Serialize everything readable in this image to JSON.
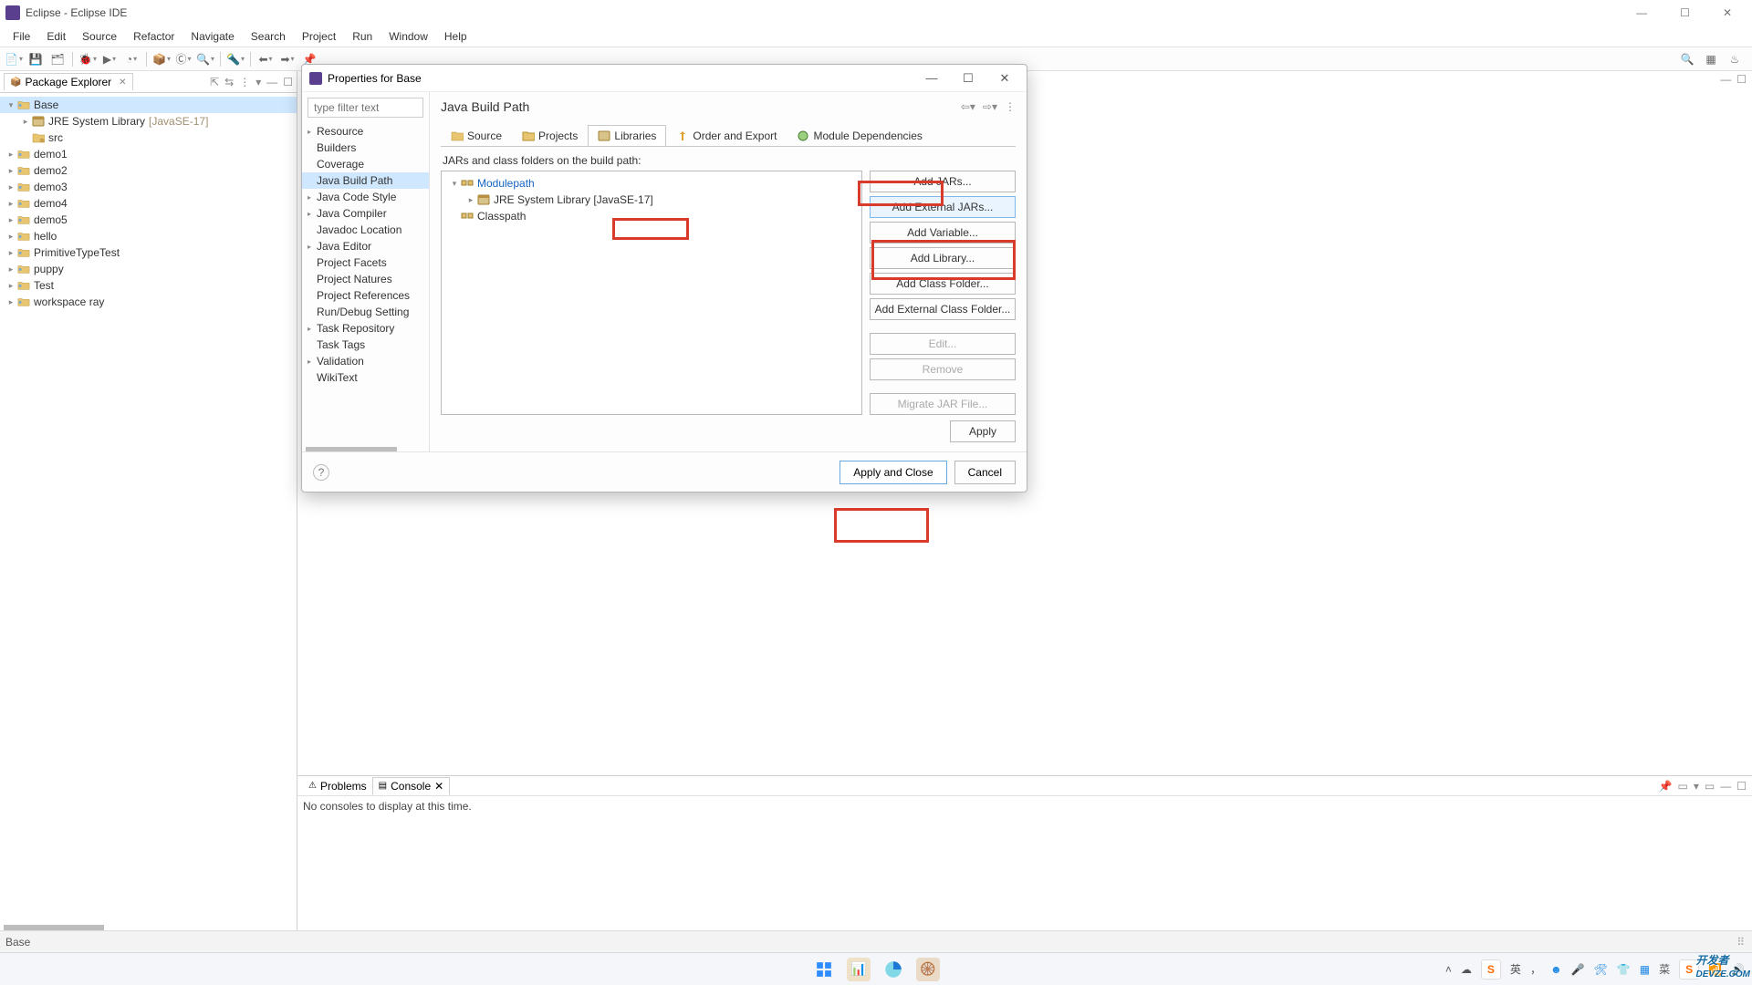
{
  "window": {
    "title": "Eclipse - Eclipse IDE"
  },
  "menu": [
    "File",
    "Edit",
    "Source",
    "Refactor",
    "Navigate",
    "Search",
    "Project",
    "Run",
    "Window",
    "Help"
  ],
  "pkg_explorer": {
    "title": "Package Explorer",
    "tree": [
      {
        "indent": 0,
        "twist": "▾",
        "icon": "project",
        "label": "Base",
        "sel": true
      },
      {
        "indent": 1,
        "twist": "▸",
        "icon": "jre",
        "label": "JRE System Library",
        "extra": "[JavaSE-17]"
      },
      {
        "indent": 1,
        "twist": "",
        "icon": "src",
        "label": "src"
      },
      {
        "indent": 0,
        "twist": "▸",
        "icon": "project",
        "label": "demo1"
      },
      {
        "indent": 0,
        "twist": "▸",
        "icon": "project",
        "label": "demo2"
      },
      {
        "indent": 0,
        "twist": "▸",
        "icon": "project",
        "label": "demo3"
      },
      {
        "indent": 0,
        "twist": "▸",
        "icon": "project",
        "label": "demo4"
      },
      {
        "indent": 0,
        "twist": "▸",
        "icon": "project",
        "label": "demo5"
      },
      {
        "indent": 0,
        "twist": "▸",
        "icon": "project",
        "label": "hello"
      },
      {
        "indent": 0,
        "twist": "▸",
        "icon": "project",
        "label": "PrimitiveTypeTest"
      },
      {
        "indent": 0,
        "twist": "▸",
        "icon": "project",
        "label": "puppy"
      },
      {
        "indent": 0,
        "twist": "▸",
        "icon": "project",
        "label": "Test"
      },
      {
        "indent": 0,
        "twist": "▸",
        "icon": "project",
        "label": "workspace ray"
      }
    ]
  },
  "bottom": {
    "tabs": {
      "problems": "Problems",
      "console": "Console"
    },
    "message": "No consoles to display at this time."
  },
  "status": {
    "text": "Base"
  },
  "dialog": {
    "title": "Properties for Base",
    "filter_placeholder": "type filter text",
    "categories": [
      {
        "tw": "▸",
        "label": "Resource"
      },
      {
        "tw": "",
        "label": "Builders"
      },
      {
        "tw": "",
        "label": "Coverage"
      },
      {
        "tw": "",
        "label": "Java Build Path",
        "sel": true
      },
      {
        "tw": "▸",
        "label": "Java Code Style"
      },
      {
        "tw": "▸",
        "label": "Java Compiler"
      },
      {
        "tw": "",
        "label": "Javadoc Location"
      },
      {
        "tw": "▸",
        "label": "Java Editor"
      },
      {
        "tw": "",
        "label": "Project Facets"
      },
      {
        "tw": "",
        "label": "Project Natures"
      },
      {
        "tw": "",
        "label": "Project References"
      },
      {
        "tw": "",
        "label": "Run/Debug Setting"
      },
      {
        "tw": "▸",
        "label": "Task Repository"
      },
      {
        "tw": "",
        "label": "Task Tags"
      },
      {
        "tw": "▸",
        "label": "Validation"
      },
      {
        "tw": "",
        "label": "WikiText"
      }
    ],
    "heading": "Java Build Path",
    "tabs": {
      "source": "Source",
      "projects": "Projects",
      "libraries": "Libraries",
      "order": "Order and Export",
      "modules": "Module Dependencies"
    },
    "jars_label": "JARs and class folders on the build path:",
    "jars_tree": [
      {
        "indent": 0,
        "tw": "▾",
        "icon": "modpath",
        "label": "Modulepath",
        "sel": true
      },
      {
        "indent": 1,
        "tw": "▸",
        "icon": "jre",
        "label": "JRE System Library [JavaSE-17]"
      },
      {
        "indent": 0,
        "tw": "",
        "icon": "classpath",
        "label": "Classpath"
      }
    ],
    "buttons": {
      "add_jars": "Add JARs...",
      "add_external_jars": "Add External JARs...",
      "add_variable": "Add Variable...",
      "add_library": "Add Library...",
      "add_class_folder": "Add Class Folder...",
      "add_external_class_folder": "Add External Class Folder...",
      "edit": "Edit...",
      "remove": "Remove",
      "migrate": "Migrate JAR File...",
      "apply": "Apply",
      "apply_close": "Apply and Close",
      "cancel": "Cancel"
    }
  },
  "taskbar": {
    "tray_lang": "英"
  },
  "watermark": {
    "big": "开发者",
    "sub": "DEVZE.COM"
  }
}
